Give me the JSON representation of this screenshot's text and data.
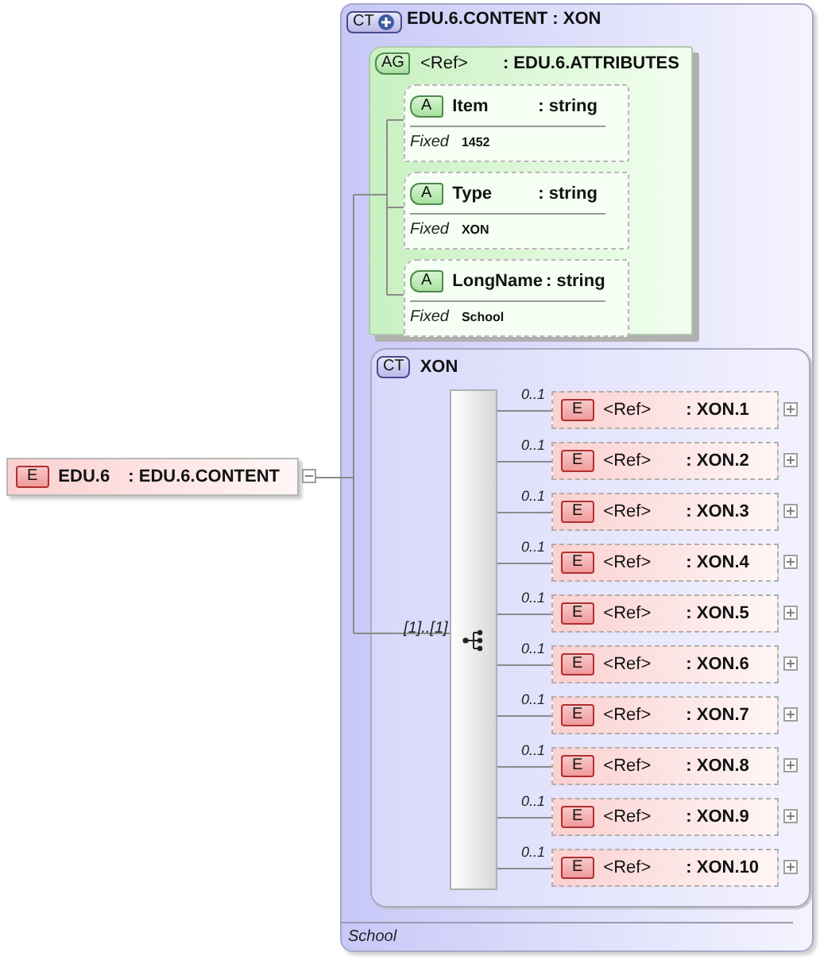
{
  "root": {
    "badge": "E",
    "name": "EDU.6",
    "type": ": EDU.6.CONTENT",
    "expanded": true
  },
  "complex_type": {
    "badge": "CT",
    "expandable": true,
    "name": "EDU.6.CONTENT : XON",
    "footer": "School",
    "attribute_group": {
      "badge": "AG",
      "name": "<Ref>",
      "type": ": EDU.6.ATTRIBUTES",
      "attributes": [
        {
          "badge": "A",
          "name": "Item",
          "type": ": string",
          "fixed_label": "Fixed",
          "fixed_value": "1452"
        },
        {
          "badge": "A",
          "name": "Type",
          "type": ": string",
          "fixed_label": "Fixed",
          "fixed_value": "XON"
        },
        {
          "badge": "A",
          "name": "LongName",
          "type": ": string",
          "fixed_label": "Fixed",
          "fixed_value": "School"
        }
      ]
    },
    "content": {
      "badge": "CT",
      "name": "XON",
      "cardinality": "[1]..[1]",
      "children": [
        {
          "occurs": "0..1",
          "badge": "E",
          "name": "<Ref>",
          "type": ": XON.1",
          "expanded": false
        },
        {
          "occurs": "0..1",
          "badge": "E",
          "name": "<Ref>",
          "type": ": XON.2",
          "expanded": false
        },
        {
          "occurs": "0..1",
          "badge": "E",
          "name": "<Ref>",
          "type": ": XON.3",
          "expanded": false
        },
        {
          "occurs": "0..1",
          "badge": "E",
          "name": "<Ref>",
          "type": ": XON.4",
          "expanded": false
        },
        {
          "occurs": "0..1",
          "badge": "E",
          "name": "<Ref>",
          "type": ": XON.5",
          "expanded": false
        },
        {
          "occurs": "0..1",
          "badge": "E",
          "name": "<Ref>",
          "type": ": XON.6",
          "expanded": false
        },
        {
          "occurs": "0..1",
          "badge": "E",
          "name": "<Ref>",
          "type": ": XON.7",
          "expanded": false
        },
        {
          "occurs": "0..1",
          "badge": "E",
          "name": "<Ref>",
          "type": ": XON.8",
          "expanded": false
        },
        {
          "occurs": "0..1",
          "badge": "E",
          "name": "<Ref>",
          "type": ": XON.9",
          "expanded": false
        },
        {
          "occurs": "0..1",
          "badge": "E",
          "name": "<Ref>",
          "type": ": XON.10",
          "expanded": false
        }
      ]
    }
  }
}
